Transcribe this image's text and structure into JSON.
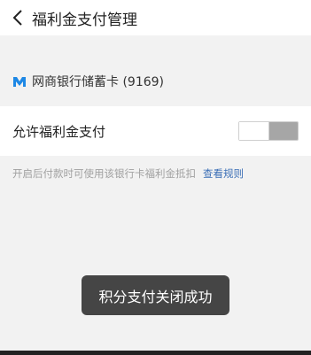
{
  "header": {
    "title": "福利金支付管理",
    "back_icon": "chevron-left-icon"
  },
  "card": {
    "icon": "bank-logo-icon",
    "name": "网商银行储蓄卡 (9169)"
  },
  "toggle": {
    "label": "允许福利金支付",
    "state": "off"
  },
  "hint": {
    "text": "开启后付款时可使用该银行卡福利金抵扣",
    "link": "查看规则"
  },
  "toast": {
    "text": "积分支付关闭成功"
  },
  "colors": {
    "link": "#3b6fb6",
    "toggle_off": "#a6a6a6",
    "toast_bg": "#323232"
  }
}
